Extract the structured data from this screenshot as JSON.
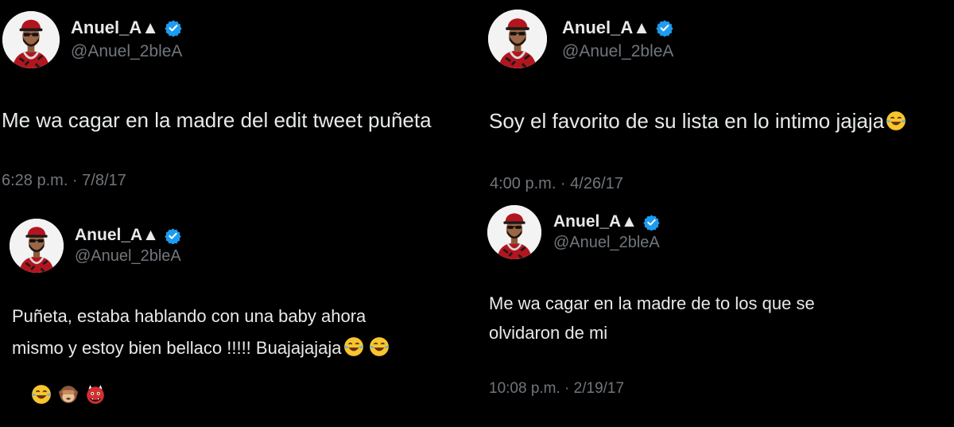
{
  "tweets": [
    {
      "display_name": "Anuel_A▲",
      "handle": "@Anuel_2bleA",
      "text": "Me wa cagar en la madre del edit tweet puñeta",
      "timestamp": "6:28 p.m. · 7/8/17"
    },
    {
      "display_name": "Anuel_A▲",
      "handle": "@Anuel_2bleA",
      "text": "Soy el favorito de su lista en lo intimo jajaja",
      "timestamp": "4:00 p.m. · 4/26/17"
    },
    {
      "display_name": "Anuel_A▲",
      "handle": "@Anuel_2bleA",
      "text_line1": "Puñeta, estaba hablando con una baby ahora",
      "text_line2": "mismo y estoy bien bellaco !!!!! Buajajajaja",
      "timestamp": ""
    },
    {
      "display_name": "Anuel_A▲",
      "handle": "@Anuel_2bleA",
      "text_line1": "Me wa cagar en la madre de to los que se",
      "text_line2": "olvidaron de mi",
      "timestamp": "10:08 p.m. · 2/19/17"
    }
  ],
  "icons": {
    "verified": "verified-badge-icon",
    "emojis": [
      "face-with-tears-of-joy-icon",
      "see-no-evil-monkey-icon",
      "ogre-icon"
    ]
  },
  "colors": {
    "background": "#000000",
    "primary_text": "#e7e9ea",
    "secondary_text": "#71767b",
    "verified_blue": "#1d9bf0"
  }
}
